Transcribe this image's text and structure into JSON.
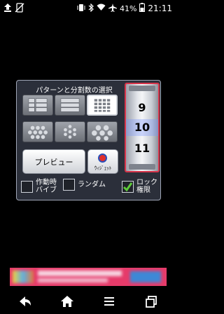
{
  "status_bar": {
    "battery_percent": "41%",
    "time": "21:11",
    "icons": [
      "upload-icon",
      "no-sim-icon",
      "bluetooth-icon",
      "vibrate-icon",
      "wifi-icon",
      "airplane-icon",
      "battery-icon"
    ]
  },
  "widget": {
    "title": "パターンと分割数の選択",
    "patterns": [
      "pattern-2col-rows",
      "pattern-3-rows",
      "pattern-grid",
      "pattern-dots",
      "pattern-dots-small",
      "pattern-hex"
    ],
    "selected_pattern_index": 2,
    "preview_label": "プレビュー",
    "widget_label": "ｳｨｼﾞｪｯﾄ",
    "drum_numbers": [
      "9",
      "10",
      "11"
    ],
    "selected_number": "10",
    "vibrate_label": "作動時バイブ",
    "vibrate_line1": "作動時",
    "vibrate_line2": "バイブ",
    "random_label": "ランダム",
    "lock_label_line1": "ロック",
    "lock_label_line2": "権限",
    "vibrate_checked": false,
    "random_checked": false,
    "lock_checked": true
  },
  "colors": {
    "panel_bg": "#2b2f3a",
    "drum_border": "#d8344a",
    "check_green": "#5ecb3a",
    "ad_bg": "#e63b6a"
  },
  "nav_bar": {
    "icons": [
      "back-icon",
      "home-icon",
      "menu-icon",
      "recents-icon"
    ]
  }
}
